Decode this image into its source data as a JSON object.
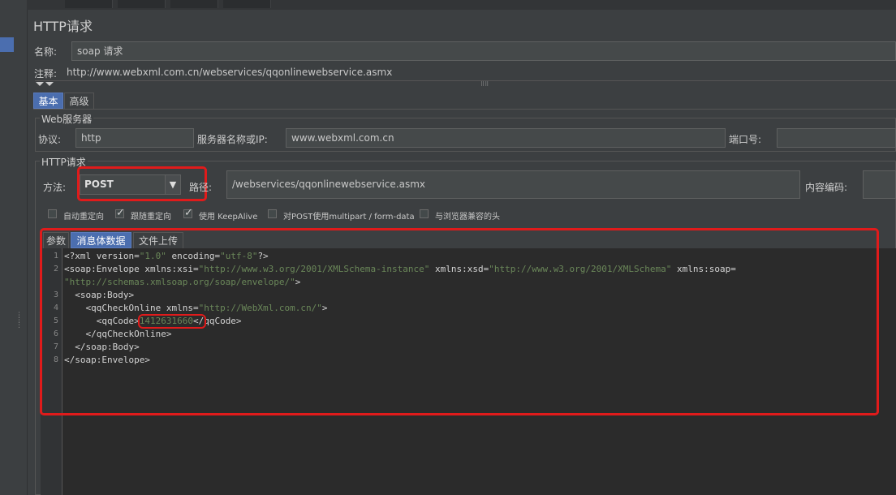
{
  "title": "HTTP请求",
  "name_label": "名称:",
  "name_value": "soap 请求",
  "comment_label": "注释:",
  "comment_value": "http://www.webxml.com.cn/webservices/qqonlinewebservice.asmx",
  "tabs": {
    "basic": "基本",
    "advanced": "高级"
  },
  "web_server": {
    "group_title": "Web服务器",
    "protocol_label": "协议:",
    "protocol_value": "http",
    "server_label": "服务器名称或IP:",
    "server_value": "www.webxml.com.cn",
    "port_label": "端口号:",
    "port_value": ""
  },
  "http_request": {
    "group_title": "HTTP请求",
    "method_label": "方法:",
    "method_value": "POST",
    "path_label": "路径:",
    "path_value": "/webservices/qqonlinewebservice.asmx",
    "encoding_label": "内容编码:",
    "encoding_value": ""
  },
  "options": [
    {
      "label": "自动重定向",
      "checked": false
    },
    {
      "label": "跟随重定向",
      "checked": true
    },
    {
      "label": "使用 KeepAlive",
      "checked": true
    },
    {
      "label": "对POST使用multipart / form-data",
      "checked": false
    },
    {
      "label": "与浏览器兼容的头",
      "checked": false
    }
  ],
  "subtabs": {
    "params": "参数",
    "body": "消息体数据",
    "files": "文件上传"
  },
  "code_lines": [
    {
      "n": "1",
      "parts": [
        [
          "t",
          "<?xml version="
        ],
        [
          "s",
          "\"1.0\""
        ],
        [
          "t",
          " encoding="
        ],
        [
          "s",
          "\"utf-8\""
        ],
        [
          "t",
          "?>"
        ]
      ]
    },
    {
      "n": "2",
      "parts": [
        [
          "t",
          "<soap:Envelope xmlns:xsi="
        ],
        [
          "s",
          "\"http://www.w3.org/2001/XMLSchema-instance\""
        ],
        [
          "t",
          " xmlns:xsd="
        ],
        [
          "s",
          "\"http://www.w3.org/2001/XMLSchema\""
        ],
        [
          "t",
          " xmlns:soap="
        ]
      ]
    },
    {
      "n": "",
      "parts": [
        [
          "s",
          "\"http://schemas.xmlsoap.org/soap/envelope/\""
        ],
        [
          "t",
          ">"
        ]
      ]
    },
    {
      "n": "3",
      "parts": [
        [
          "t",
          "  <soap:Body>"
        ]
      ]
    },
    {
      "n": "4",
      "parts": [
        [
          "t",
          "    <qqCheckOnline xmlns="
        ],
        [
          "s",
          "\"http://WebXml.com.cn/\""
        ],
        [
          "t",
          ">"
        ]
      ]
    },
    {
      "n": "5",
      "parts": [
        [
          "t",
          "      <qqCode>"
        ],
        [
          "s",
          "1412631660"
        ],
        [
          "t",
          "</qqCode>"
        ]
      ]
    },
    {
      "n": "6",
      "parts": [
        [
          "t",
          "    </qqCheckOnline>"
        ]
      ]
    },
    {
      "n": "7",
      "parts": [
        [
          "t",
          "  </soap:Body>"
        ]
      ]
    },
    {
      "n": "8",
      "parts": [
        [
          "t",
          "</soap:Envelope>"
        ]
      ]
    }
  ],
  "colors": {
    "accent": "#4b6eaf",
    "highlight": "#e01b1b",
    "string": "#6a8759"
  }
}
